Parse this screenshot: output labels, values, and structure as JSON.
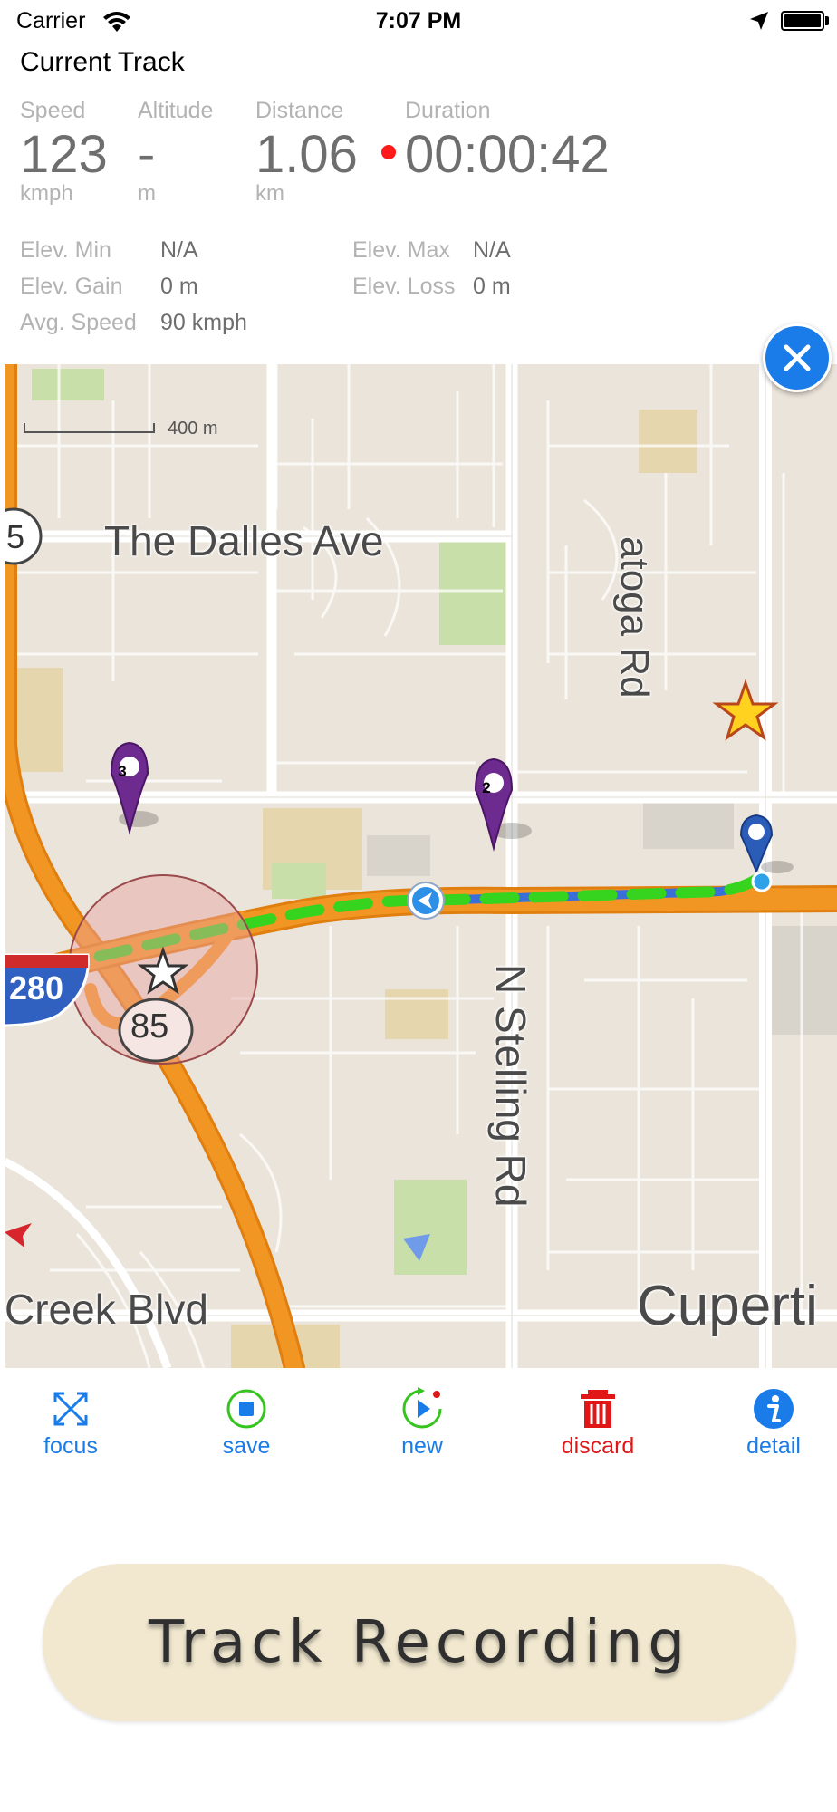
{
  "status_bar": {
    "carrier": "Carrier",
    "time": "7:07 PM"
  },
  "header": {
    "title": "Current Track"
  },
  "stats": [
    {
      "label": "Speed",
      "value": "123",
      "unit": "kmph"
    },
    {
      "label": "Altitude",
      "value": "-",
      "unit": "m"
    },
    {
      "label": "Distance",
      "value": "1.06",
      "unit": "km"
    },
    {
      "label": "Duration",
      "value": "00:00:42",
      "unit": ""
    }
  ],
  "details": {
    "elev_min_label": "Elev. Min",
    "elev_min_value": "N/A",
    "elev_max_label": "Elev. Max",
    "elev_max_value": "N/A",
    "elev_gain_label": "Elev. Gain",
    "elev_gain_value": "0 m",
    "elev_loss_label": "Elev. Loss",
    "elev_loss_value": "0 m",
    "avg_speed_label": "Avg. Speed",
    "avg_speed_value": "90 kmph"
  },
  "map": {
    "scale": "400 m",
    "streets": {
      "dalles": "The Dalles Ave",
      "saratoga": "atoga Rd",
      "stelling": "N Stelling Rd",
      "creek": "Creek Blvd",
      "cupertino": "Cuperti",
      "hwy85": "85",
      "hwy280": "280",
      "hwy_left": "5"
    },
    "waypoints": [
      "3",
      "2"
    ],
    "colors": {
      "route_done": "#3a6fd8",
      "route_pending": "#36d41e",
      "highway": "#f29623"
    }
  },
  "toolbar": {
    "focus": "focus",
    "save": "save",
    "new": "new",
    "discard": "discard",
    "detail": "detail"
  },
  "record_button": {
    "label": "Track Recording"
  }
}
